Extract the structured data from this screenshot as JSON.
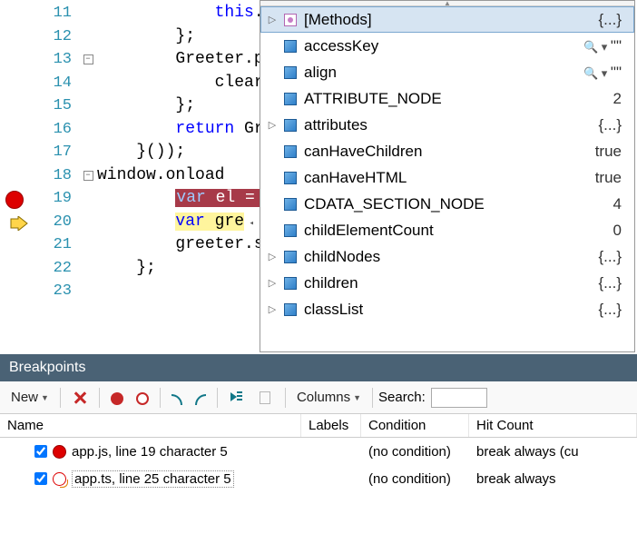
{
  "editor": {
    "lines": [
      {
        "num": 11,
        "fold": "",
        "text": "            this."
      },
      {
        "num": 12,
        "fold": "",
        "text": "        };"
      },
      {
        "num": 13,
        "fold": "minus",
        "text": "        Greeter.p"
      },
      {
        "num": 14,
        "fold": "",
        "text": "            clear"
      },
      {
        "num": 15,
        "fold": "",
        "text": "        };"
      },
      {
        "num": 16,
        "fold": "",
        "text_pre": "        ",
        "kw": "return",
        "text_post": " Gr"
      },
      {
        "num": 17,
        "fold": "",
        "text": "    }());"
      },
      {
        "num": 18,
        "fold": "minus",
        "text": "window.onload"
      },
      {
        "num": 19,
        "fold": "",
        "text": "",
        "highlight": "red",
        "hl_pre": "        ",
        "hl_kw": "var",
        "hl_rest": " el = "
      },
      {
        "num": 20,
        "fold": "",
        "text": "",
        "highlight": "yellow",
        "hl_pre": "        ",
        "hl_kw": "var",
        "hl_rest": " gre",
        "trail_tri": true
      },
      {
        "num": 21,
        "fold": "",
        "text": "        greeter.s"
      },
      {
        "num": 22,
        "fold": "",
        "text": "    };"
      },
      {
        "num": 23,
        "fold": "",
        "text": ""
      }
    ],
    "margin": {
      "breakpoint_row": 19,
      "current_row": 20
    }
  },
  "popup": {
    "items": [
      {
        "expand": true,
        "icon": "methods",
        "label": "[Methods]",
        "value": "{...}",
        "selected": true
      },
      {
        "expand": false,
        "icon": "cube",
        "label": "accessKey",
        "value": "\"\"",
        "mag": true
      },
      {
        "expand": false,
        "icon": "cube",
        "label": "align",
        "value": "\"\"",
        "mag": true
      },
      {
        "expand": false,
        "icon": "cube",
        "label": "ATTRIBUTE_NODE",
        "value": "2"
      },
      {
        "expand": true,
        "icon": "cube",
        "label": "attributes",
        "value": "{...}"
      },
      {
        "expand": false,
        "icon": "cube",
        "label": "canHaveChildren",
        "value": "true"
      },
      {
        "expand": false,
        "icon": "cube",
        "label": "canHaveHTML",
        "value": "true"
      },
      {
        "expand": false,
        "icon": "cube",
        "label": "CDATA_SECTION_NODE",
        "value": "4"
      },
      {
        "expand": false,
        "icon": "cube",
        "label": "childElementCount",
        "value": "0"
      },
      {
        "expand": true,
        "icon": "cube",
        "label": "childNodes",
        "value": "{...}"
      },
      {
        "expand": true,
        "icon": "cube",
        "label": "children",
        "value": "{...}"
      },
      {
        "expand": true,
        "icon": "cube",
        "label": "classList",
        "value": "{...}"
      }
    ]
  },
  "panel": {
    "title": "Breakpoints",
    "toolbar": {
      "new": "New",
      "columns": "Columns",
      "search_label": "Search:",
      "search_value": ""
    },
    "headers": {
      "name": "Name",
      "labels": "Labels",
      "cond": "Condition",
      "hit": "Hit Count"
    },
    "rows": [
      {
        "checked": true,
        "icon": "solid",
        "name": "app.js, line 19 character 5",
        "labels": "",
        "cond": "(no condition)",
        "hit": "break always (cu"
      },
      {
        "checked": true,
        "icon": "mapped",
        "name": "app.ts, line 25 character 5",
        "labels": "",
        "cond": "(no condition)",
        "hit": "break always",
        "selected": true
      }
    ]
  }
}
